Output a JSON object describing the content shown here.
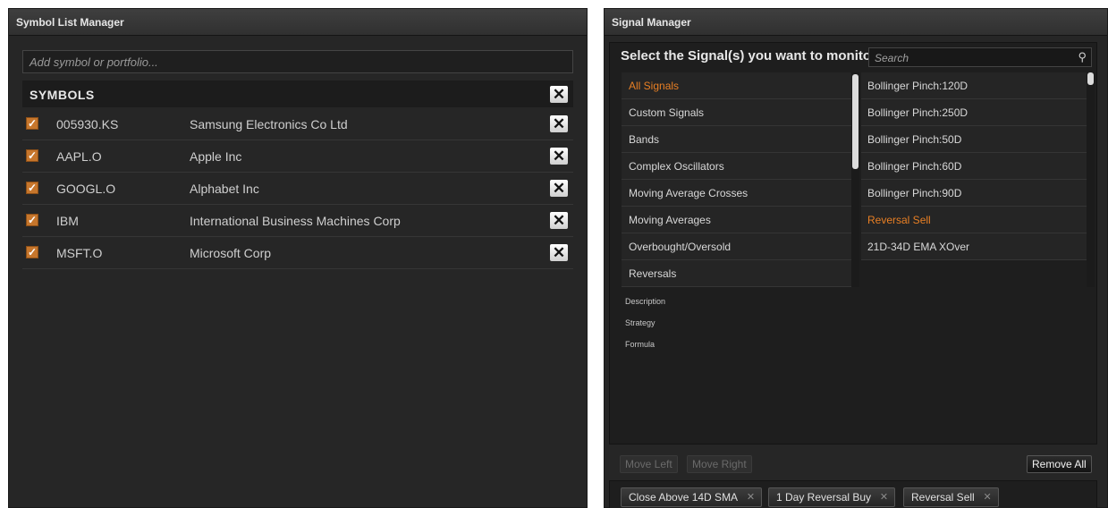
{
  "symbol_manager": {
    "title": "Symbol List Manager",
    "add_placeholder": "Add symbol or portfolio...",
    "header": "SYMBOLS",
    "rows": [
      {
        "code": "005930.KS",
        "name": "Samsung Electronics Co Ltd",
        "checked": true
      },
      {
        "code": "AAPL.O",
        "name": "Apple Inc",
        "checked": true
      },
      {
        "code": "GOOGL.O",
        "name": "Alphabet Inc",
        "checked": true
      },
      {
        "code": "IBM",
        "name": "International Business Machines Corp",
        "checked": true
      },
      {
        "code": "MSFT.O",
        "name": "Microsoft Corp",
        "checked": true
      }
    ]
  },
  "signal_manager": {
    "title": "Signal Manager",
    "heading": "Select the Signal(s) you want to monitor",
    "search_placeholder": "Search",
    "categories": [
      {
        "label": "All Signals",
        "selected": true
      },
      {
        "label": "Custom Signals",
        "selected": false
      },
      {
        "label": "Bands",
        "selected": false
      },
      {
        "label": "Complex Oscillators",
        "selected": false
      },
      {
        "label": "Moving Average Crosses",
        "selected": false
      },
      {
        "label": "Moving Averages",
        "selected": false
      },
      {
        "label": "Overbought/Oversold",
        "selected": false
      },
      {
        "label": "Reversals",
        "selected": false
      }
    ],
    "signals": [
      {
        "label": "Bollinger Pinch:120D",
        "selected": false
      },
      {
        "label": "Bollinger Pinch:250D",
        "selected": false
      },
      {
        "label": "Bollinger Pinch:50D",
        "selected": false
      },
      {
        "label": "Bollinger Pinch:60D",
        "selected": false
      },
      {
        "label": "Bollinger Pinch:90D",
        "selected": false
      },
      {
        "label": "Reversal Sell",
        "selected": true
      },
      {
        "label": "21D-34D EMA XOver",
        "selected": false
      }
    ],
    "info_labels": [
      "Description",
      "Strategy",
      "Formula"
    ],
    "buttons": {
      "move_left": "Move Left",
      "move_right": "Move Right",
      "remove_all": "Remove All"
    },
    "selected_chips": [
      "Close Above 14D SMA",
      "1 Day Reversal Buy",
      "Reversal Sell"
    ]
  },
  "colors": {
    "accent": "#e87f24",
    "panel": "#262626",
    "checkbox": "#c6762c"
  }
}
